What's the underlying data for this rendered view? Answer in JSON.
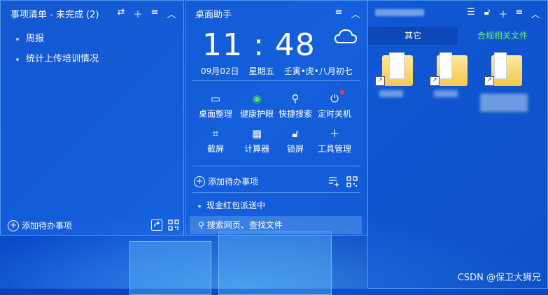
{
  "todo": {
    "title": "事项清单 - 未完成 (2)",
    "items": [
      "周报",
      "统计上传培训情况"
    ],
    "add_label": "添加待办事项",
    "header_icons": [
      "swap-icon",
      "plus-icon",
      "menu-icon",
      "collapse-icon"
    ]
  },
  "assistant": {
    "title": "桌面助手",
    "time": "11 : 48",
    "date": "09月02日",
    "weekday": "星期五",
    "lunar": "壬寅•虎•八月初七",
    "tools": [
      {
        "label": "桌面整理",
        "icon": "monitor-icon"
      },
      {
        "label": "健康护眼",
        "icon": "eye-icon"
      },
      {
        "label": "快捷搜索",
        "icon": "search-icon"
      },
      {
        "label": "定时关机",
        "icon": "power-icon"
      },
      {
        "label": "截屏",
        "icon": "crop-icon"
      },
      {
        "label": "计算器",
        "icon": "calculator-icon"
      },
      {
        "label": "锁屏",
        "icon": "lock-icon"
      },
      {
        "label": "工具管理",
        "icon": "plus-icon"
      }
    ],
    "add_todo_label": "添加待办事项",
    "promo": "现金红包派送中",
    "search_placeholder": "搜索网页、查找文件"
  },
  "files": {
    "tabs": [
      {
        "label": "其它",
        "active": true
      },
      {
        "label": "合规相关文件",
        "active": false
      }
    ]
  },
  "colors": {
    "accent_green": "#6ff06f",
    "alert_red": "#ff3b3b"
  },
  "watermark": "CSDN @保卫大狮兄"
}
